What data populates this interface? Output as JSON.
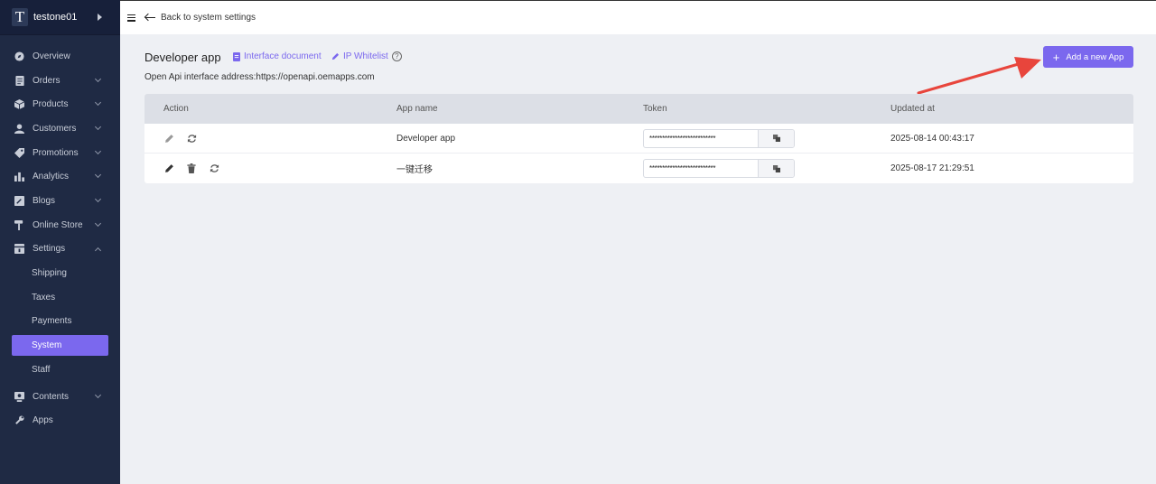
{
  "brand": {
    "logo_letter": "T",
    "name": "testone01"
  },
  "sidebar": {
    "items": [
      {
        "label": "Overview",
        "icon": "overview-icon"
      },
      {
        "label": "Orders",
        "icon": "orders-icon"
      },
      {
        "label": "Products",
        "icon": "products-icon"
      },
      {
        "label": "Customers",
        "icon": "customers-icon"
      },
      {
        "label": "Promotions",
        "icon": "promotions-icon"
      },
      {
        "label": "Analytics",
        "icon": "analytics-icon"
      },
      {
        "label": "Blogs",
        "icon": "blogs-icon"
      },
      {
        "label": "Online Store",
        "icon": "online-store-icon"
      },
      {
        "label": "Settings",
        "icon": "settings-icon"
      }
    ],
    "settings_sub": [
      "Shipping",
      "Taxes",
      "Payments",
      "System",
      "Staff"
    ],
    "active_sub": "System",
    "items_after": [
      {
        "label": "Contents",
        "icon": "contents-icon"
      },
      {
        "label": "Apps",
        "icon": "apps-icon"
      }
    ]
  },
  "topbar": {
    "back_label": "Back to system settings"
  },
  "page": {
    "title": "Developer app",
    "interface_doc": "Interface document",
    "ip_whitelist": "IP Whitelist",
    "help": "?",
    "api_address": "Open Api interface address:https://openapi.oemapps.com",
    "add_button": "Add a new App"
  },
  "table": {
    "headers": [
      "Action",
      "App name",
      "Token",
      "Updated at"
    ],
    "rows": [
      {
        "app_name": "Developer app",
        "token": "**************************",
        "updated": "2025-08-14 00:43:17"
      },
      {
        "app_name": "一键迁移",
        "token": "**************************",
        "updated": "2025-08-17 21:29:51"
      }
    ]
  },
  "colors": {
    "accent": "#7b68ee",
    "sidebar_bg": "#1f2a44",
    "arrow": "#e8453c"
  }
}
